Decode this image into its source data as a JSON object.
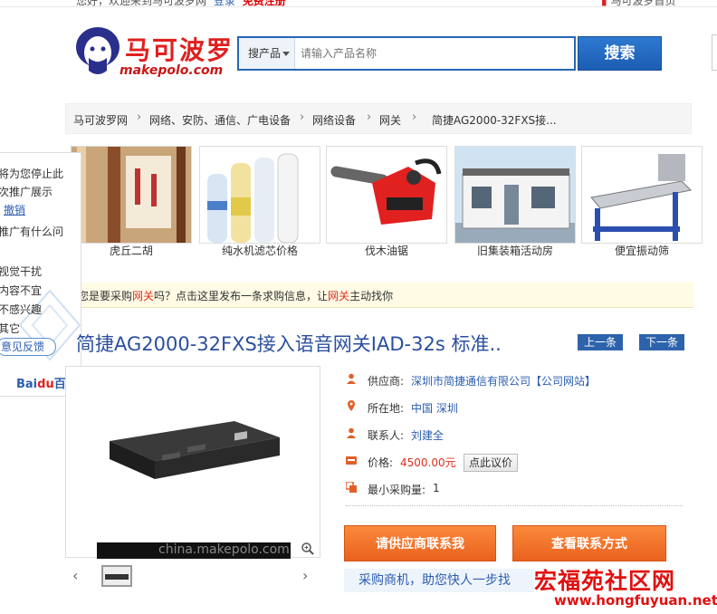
{
  "topbar": {
    "welcome": "您好，欢迎来到马可波罗网",
    "login": "登录",
    "register": "免费注册",
    "right": "马可波罗首页"
  },
  "logo": {
    "cn": "马可波罗",
    "en": "makepolo.com"
  },
  "search": {
    "category": "搜产品",
    "placeholder": "请输入产品名称",
    "button": "搜索"
  },
  "breadcrumb": [
    "马可波罗网",
    "网络、安防、通信、广电设备",
    "网络设备",
    "网关",
    "简捷AG2000-32FXS接..."
  ],
  "related_products": [
    {
      "label": "虎丘二胡"
    },
    {
      "label": "纯水机滤芯价格"
    },
    {
      "label": "伐木油锯"
    },
    {
      "label": "旧集装箱活动房"
    },
    {
      "label": "便宜振动筛"
    }
  ],
  "side_ad": {
    "lines": [
      "将为您停止此",
      "次推广展示",
      "撤销",
      "推广有什么问",
      "视觉干扰",
      "内容不宜",
      "不感兴趣",
      "其它"
    ],
    "feedback": "意见反馈",
    "baidu": "Bai",
    "baidu_du": "du",
    "baidu_cn": "百度"
  },
  "notice": {
    "prefix": "您是要采购",
    "kw1": "网关",
    "middle": "吗？点击这里发布一条求购信息，让",
    "kw2": "网关",
    "suffix": "主动找你"
  },
  "product": {
    "title": "简捷AG2000-32FXS接入语音网关IAD-32s 标准..",
    "prev": "上一条",
    "next": "下一条",
    "image_watermark": "china.makepolo.com"
  },
  "info": {
    "supplier_label": "供应商:",
    "supplier_value": "深圳市简捷通信有限公司",
    "supplier_site": "【公司网站】",
    "location_label": "所在地:",
    "location_value": "中国 深圳",
    "contact_label": "联系人:",
    "contact_value": "刘建全",
    "price_label": "价格:",
    "price_value": "4500.00元",
    "price_button": "点此议价",
    "minorder_label": "最小采购量:",
    "minorder_value": "1"
  },
  "actions": {
    "contact": "请供应商联系我",
    "view_contact": "查看联系方式",
    "buyer_tip": "采购商机，助您快人一步找"
  },
  "watermark": {
    "big": "宏福苑社区网",
    "small": "www.hongfuyuan.net"
  },
  "colors": {
    "brand_red": "#e02020",
    "link_blue": "#2b5db0",
    "search_blue": "#2766b8",
    "action_orange": "#f47a2c"
  }
}
